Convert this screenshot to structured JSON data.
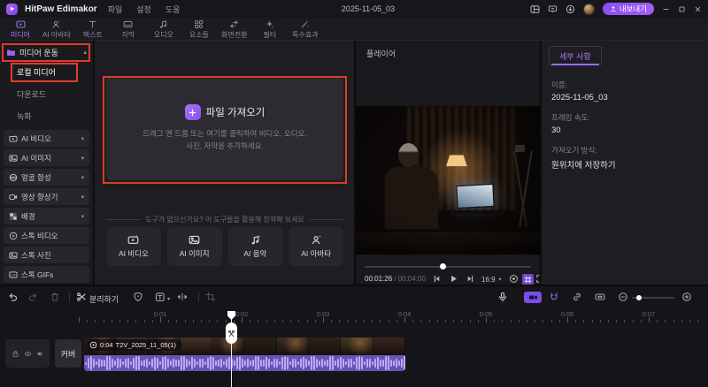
{
  "titlebar": {
    "app_name": "HitPaw Edimakor",
    "menus": [
      "파일",
      "설정",
      "도움"
    ],
    "project_title": "2025-11-05_03",
    "export_label": "내보내기",
    "right_icons": [
      "layout-icon",
      "feedback-icon",
      "download-icon",
      "avatar"
    ],
    "window_controls": [
      "minimize",
      "maximize",
      "close"
    ]
  },
  "tabs": [
    {
      "label": "미디어",
      "icon": "media",
      "active": true
    },
    {
      "label": "AI 아바타",
      "icon": "ai-avatar",
      "active": false
    },
    {
      "label": "텍스트",
      "icon": "text",
      "active": false
    },
    {
      "label": "자막",
      "icon": "subtitle",
      "active": false
    },
    {
      "label": "오디오",
      "icon": "audio",
      "active": false
    },
    {
      "label": "요소들",
      "icon": "elements",
      "active": false
    },
    {
      "label": "화면전환",
      "icon": "transition",
      "active": false
    },
    {
      "label": "필터",
      "icon": "filter",
      "active": false
    },
    {
      "label": "특수효과",
      "icon": "effects",
      "active": false
    }
  ],
  "sidebar": {
    "section": {
      "label": "미디어 운동",
      "icon": "folder",
      "expanded": true
    },
    "sub_items": [
      {
        "label": "로컬 미디어",
        "active": true
      },
      {
        "label": "다운로드",
        "active": false
      },
      {
        "label": "녹화",
        "active": false
      }
    ],
    "groups": [
      {
        "label": "AI 비디오",
        "icon": "ai-video",
        "collapsible": true
      },
      {
        "label": "AI 이미지",
        "icon": "ai-image",
        "collapsible": true
      },
      {
        "label": "얼굴 합성",
        "icon": "face-swap",
        "collapsible": true
      },
      {
        "label": "영상 향상기",
        "icon": "enhancer",
        "collapsible": true
      },
      {
        "label": "배경",
        "icon": "background",
        "collapsible": true
      },
      {
        "label": "스톡 비디오",
        "icon": "stock-video",
        "collapsible": false
      },
      {
        "label": "스톡 사진",
        "icon": "stock-photo",
        "collapsible": false
      },
      {
        "label": "스톡 GIFs",
        "icon": "stock-gif",
        "collapsible": false
      }
    ]
  },
  "media_panel": {
    "import_title": "파일 가져오기",
    "import_desc_line1": "드래그 앤 드롭 또는 여기를 클릭하여 비디오, 오디오,",
    "import_desc_line2": "사진, 자막을 추가하세요.",
    "tools_divider": "도구가 없으신가요? 이 도구들을 활용해 창작해 보세요",
    "ai_tools": [
      {
        "label": "AI 비디오",
        "icon": "ai-video"
      },
      {
        "label": "AI 이미지",
        "icon": "ai-image"
      },
      {
        "label": "AI 음악",
        "icon": "ai-music"
      },
      {
        "label": "AI 아바타",
        "icon": "ai-avatar"
      }
    ]
  },
  "player": {
    "title": "플레이어",
    "current_time": "00:01:26",
    "time_sep": " / ",
    "total_time": "00:04:00",
    "aspect_ratio": "16:9",
    "progress_percent": 47
  },
  "details": {
    "tab": "세부 사항",
    "fields": [
      {
        "label": "이름:",
        "value": "2025-11-05_03"
      },
      {
        "label": "프레임 속도:",
        "value": "30"
      },
      {
        "label": "가져오기 방식:",
        "value": "원위치에 저장하기"
      }
    ]
  },
  "timeline": {
    "split_label": "분리하기",
    "cover_label": "커버",
    "clip": {
      "duration": "0:04",
      "name": "T2V_2025_11_05(1)"
    },
    "ruler_labels": [
      "0:01",
      "0:02",
      "0:03",
      "0:04",
      "0:05",
      "0:06",
      "0:07"
    ],
    "playhead_time": "0:02"
  },
  "colors": {
    "accent": "#9b6bff",
    "annotation_red": "#de3c2c",
    "waveform": "#beaaee",
    "clip_base": "#6752b8",
    "export_gradient_start": "#8a4ff0",
    "export_gradient_end": "#a35cf5"
  }
}
